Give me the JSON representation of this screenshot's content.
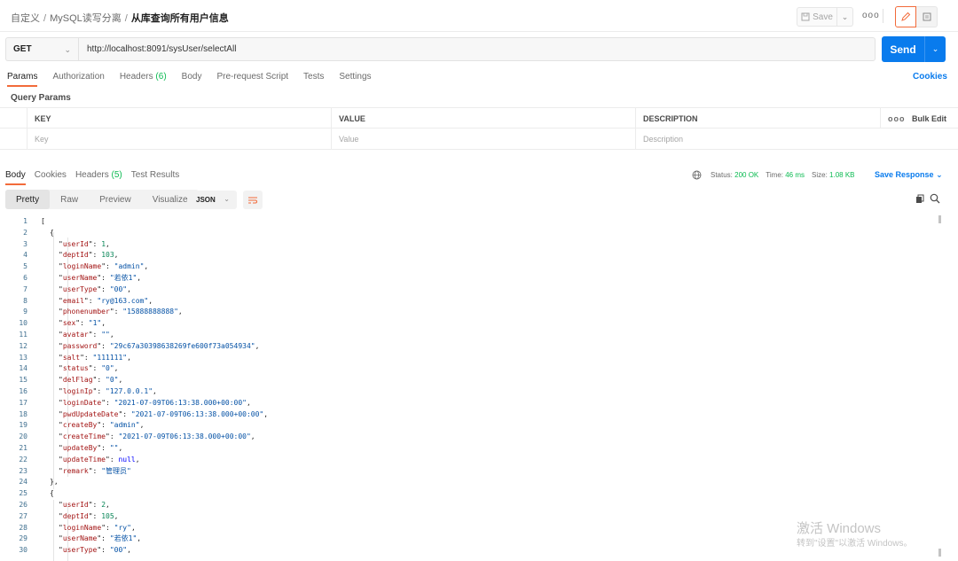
{
  "breadcrumb": {
    "items": [
      "自定义",
      "MySQL读写分离"
    ],
    "separator": "/",
    "current": "从库查询所有用户信息"
  },
  "toolbar": {
    "save_label": "Save",
    "more_label": "ooo"
  },
  "request": {
    "method": "GET",
    "url": "http://localhost:8091/sysUser/selectAll",
    "send_label": "Send"
  },
  "request_tabs": [
    {
      "label": "Params",
      "count": ""
    },
    {
      "label": "Authorization",
      "count": ""
    },
    {
      "label": "Headers",
      "count": "(6)"
    },
    {
      "label": "Body",
      "count": ""
    },
    {
      "label": "Pre-request Script",
      "count": ""
    },
    {
      "label": "Tests",
      "count": ""
    },
    {
      "label": "Settings",
      "count": ""
    }
  ],
  "cookies_link": "Cookies",
  "query_params": {
    "title": "Query Params",
    "headers": {
      "key": "KEY",
      "value": "VALUE",
      "description": "DESCRIPTION",
      "more": "ooo",
      "bulk_edit": "Bulk Edit"
    },
    "placeholders": {
      "key": "Key",
      "value": "Value",
      "description": "Description"
    }
  },
  "response_tabs": [
    {
      "label": "Body",
      "count": ""
    },
    {
      "label": "Cookies",
      "count": ""
    },
    {
      "label": "Headers",
      "count": "(5)"
    },
    {
      "label": "Test Results",
      "count": ""
    }
  ],
  "status": {
    "status_label": "Status:",
    "status_value": "200 OK",
    "time_label": "Time:",
    "time_value": "46 ms",
    "size_label": "Size:",
    "size_value": "1.08 KB"
  },
  "save_response": "Save Response",
  "format": {
    "views": [
      "Pretty",
      "Raw",
      "Preview",
      "Visualize"
    ],
    "active": "Pretty",
    "type": "JSON"
  },
  "code_lines": [
    {
      "n": "1",
      "indent": 0,
      "open": "["
    },
    {
      "n": "2",
      "indent": 1,
      "open": "{"
    },
    {
      "n": "3",
      "indent": 2,
      "key": "userId",
      "val": "1",
      "vt": "n",
      "comma": true
    },
    {
      "n": "4",
      "indent": 2,
      "key": "deptId",
      "val": "103",
      "vt": "n",
      "comma": true
    },
    {
      "n": "5",
      "indent": 2,
      "key": "loginName",
      "val": "admin",
      "vt": "s",
      "comma": true
    },
    {
      "n": "6",
      "indent": 2,
      "key": "userName",
      "val": "若依1",
      "vt": "s",
      "comma": true
    },
    {
      "n": "7",
      "indent": 2,
      "key": "userType",
      "val": "00",
      "vt": "s",
      "comma": true
    },
    {
      "n": "8",
      "indent": 2,
      "key": "email",
      "val": "ry@163.com",
      "vt": "s",
      "comma": true
    },
    {
      "n": "9",
      "indent": 2,
      "key": "phonenumber",
      "val": "15888888888",
      "vt": "s",
      "comma": true
    },
    {
      "n": "10",
      "indent": 2,
      "key": "sex",
      "val": "1",
      "vt": "s",
      "comma": true
    },
    {
      "n": "11",
      "indent": 2,
      "key": "avatar",
      "val": "",
      "vt": "s",
      "comma": true
    },
    {
      "n": "12",
      "indent": 2,
      "key": "password",
      "val": "29c67a30398638269fe600f73a054934",
      "vt": "s",
      "comma": true
    },
    {
      "n": "13",
      "indent": 2,
      "key": "salt",
      "val": "111111",
      "vt": "s",
      "comma": true
    },
    {
      "n": "14",
      "indent": 2,
      "key": "status",
      "val": "0",
      "vt": "s",
      "comma": true
    },
    {
      "n": "15",
      "indent": 2,
      "key": "delFlag",
      "val": "0",
      "vt": "s",
      "comma": true
    },
    {
      "n": "16",
      "indent": 2,
      "key": "loginIp",
      "val": "127.0.0.1",
      "vt": "s",
      "comma": true
    },
    {
      "n": "17",
      "indent": 2,
      "key": "loginDate",
      "val": "2021-07-09T06:13:38.000+00:00",
      "vt": "s",
      "comma": true
    },
    {
      "n": "18",
      "indent": 2,
      "key": "pwdUpdateDate",
      "val": "2021-07-09T06:13:38.000+00:00",
      "vt": "s",
      "comma": true
    },
    {
      "n": "19",
      "indent": 2,
      "key": "createBy",
      "val": "admin",
      "vt": "s",
      "comma": true
    },
    {
      "n": "20",
      "indent": 2,
      "key": "createTime",
      "val": "2021-07-09T06:13:38.000+00:00",
      "vt": "s",
      "comma": true
    },
    {
      "n": "21",
      "indent": 2,
      "key": "updateBy",
      "val": "",
      "vt": "s",
      "comma": true
    },
    {
      "n": "22",
      "indent": 2,
      "key": "updateTime",
      "val": "null",
      "vt": "kw",
      "comma": true
    },
    {
      "n": "23",
      "indent": 2,
      "key": "remark",
      "val": "管理员",
      "vt": "s",
      "comma": false
    },
    {
      "n": "24",
      "indent": 1,
      "close": "},"
    },
    {
      "n": "25",
      "indent": 1,
      "open": "{"
    },
    {
      "n": "26",
      "indent": 2,
      "key": "userId",
      "val": "2",
      "vt": "n",
      "comma": true
    },
    {
      "n": "27",
      "indent": 2,
      "key": "deptId",
      "val": "105",
      "vt": "n",
      "comma": true
    },
    {
      "n": "28",
      "indent": 2,
      "key": "loginName",
      "val": "ry",
      "vt": "s",
      "comma": true
    },
    {
      "n": "29",
      "indent": 2,
      "key": "userName",
      "val": "若依1",
      "vt": "s",
      "comma": true
    },
    {
      "n": "30",
      "indent": 2,
      "key": "userType",
      "val": "00",
      "vt": "s",
      "comma": true
    }
  ],
  "watermark": {
    "line1": "激活 Windows",
    "line2": "转到\"设置\"以激活 Windows。"
  },
  "colors": {
    "accent": "#f26b3a",
    "send": "#097bed",
    "ok": "#0cbb52",
    "link": "#097bed"
  }
}
